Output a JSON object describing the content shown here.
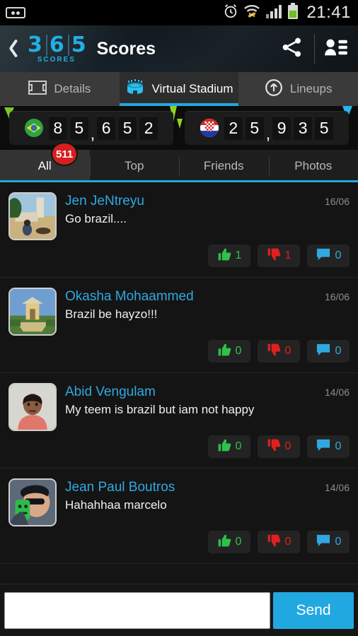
{
  "statusbar": {
    "time": "21:41",
    "icons": [
      "voicemail-icon",
      "alarm-icon",
      "wifi-icon",
      "signal-icon",
      "battery-icon"
    ]
  },
  "actionbar": {
    "back": "back-icon",
    "logo_digits": [
      "3",
      "6",
      "5"
    ],
    "logo_sub": "SCORES",
    "title": "Scores",
    "share": "share-icon",
    "contacts": "contacts-icon"
  },
  "section_tabs": [
    {
      "label": "Details",
      "icon": "pitch-icon",
      "active": false
    },
    {
      "label": "Virtual Stadium",
      "icon": "stadium-icon",
      "active": true
    },
    {
      "label": "Lineups",
      "icon": "arrow-up-circle-icon",
      "active": false
    }
  ],
  "banner": {
    "home": {
      "team": "Brazil",
      "flag": "brazil-flag",
      "score": "85,652",
      "digits": [
        "8",
        "5",
        ",",
        "6",
        "5",
        "2"
      ]
    },
    "away": {
      "team": "Croatia",
      "flag": "croatia-flag",
      "score": "25,935",
      "digits": [
        "2",
        "5",
        ",",
        "9",
        "3",
        "5"
      ]
    }
  },
  "filter_tabs": [
    {
      "label": "All",
      "active": true,
      "badge": "511"
    },
    {
      "label": "Top",
      "active": false
    },
    {
      "label": "Friends",
      "active": false
    },
    {
      "label": "Photos",
      "active": false
    }
  ],
  "comments": [
    {
      "user": "Jen JeNtreyu",
      "text": "Go brazil....",
      "date": "16/06",
      "likes": "1",
      "dislikes": "1",
      "replies": "0",
      "avatar": "photo-street"
    },
    {
      "user": "Okasha Mohaammed",
      "text": "Brazil be hayzo!!!",
      "date": "16/06",
      "likes": "0",
      "dislikes": "0",
      "replies": "0",
      "avatar": "photo-monument"
    },
    {
      "user": "Abid Vengulam",
      "text": "My teem is brazil but iam not happy",
      "date": "14/06",
      "likes": "0",
      "dislikes": "0",
      "replies": "0",
      "avatar": "photo-portrait"
    },
    {
      "user": "Jean Paul Boutros",
      "text": "Hahahhaa marcelo",
      "date": "14/06",
      "likes": "0",
      "dislikes": "0",
      "replies": "0",
      "avatar": "photo-selfie"
    }
  ],
  "composer": {
    "value": "",
    "placeholder": "",
    "send_label": "Send"
  },
  "colors": {
    "accent": "#21a8e0",
    "like": "#2ec24a",
    "dislike": "#e02020",
    "badge": "#d61f1f",
    "username": "#2fa9e0"
  }
}
